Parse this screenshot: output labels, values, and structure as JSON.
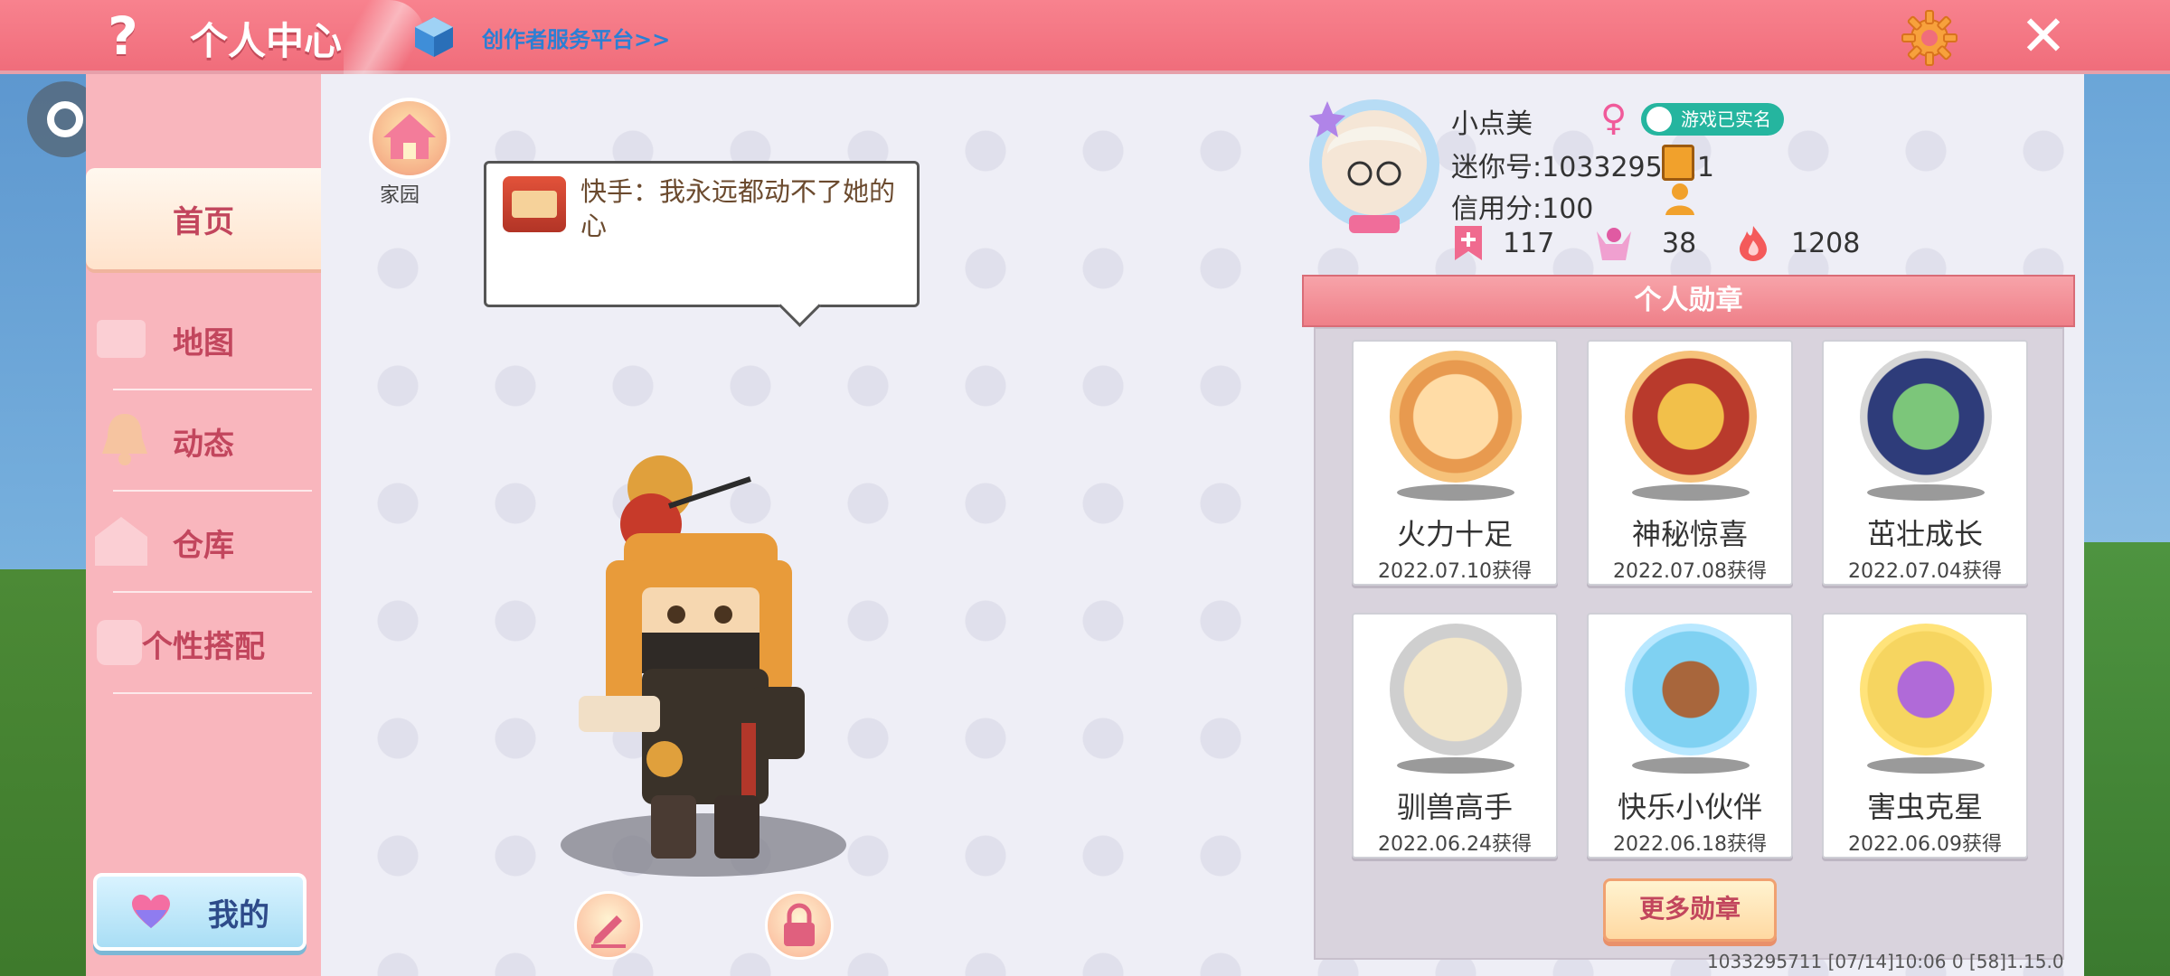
{
  "header": {
    "title": "个人中心",
    "creator_link": "创作者服务平台>>",
    "help_glyph": "?",
    "close_glyph": "✕"
  },
  "sidebar": {
    "items": [
      {
        "label": "首页",
        "active": true
      },
      {
        "label": "地图"
      },
      {
        "label": "动态"
      },
      {
        "label": "仓库"
      },
      {
        "label": "个性搭配"
      }
    ],
    "mine_label": "我的"
  },
  "main": {
    "home_label": "家园",
    "speech_text": "快手：我永远都动不了她的心"
  },
  "profile": {
    "name": "小点美",
    "gender_glyph": "♀",
    "verified_label": "游戏已实名",
    "mini_id": "迷你号:1033295711",
    "credit": "信用分:100",
    "stats": {
      "likes": "117",
      "fans": "38",
      "heat": "1208"
    }
  },
  "medals": {
    "header": "个人勋章",
    "items": [
      {
        "name": "火力十足",
        "date": "2022.07.10获得",
        "color": "#e89a4f"
      },
      {
        "name": "神秘惊喜",
        "date": "2022.07.08获得",
        "color": "#d9853f"
      },
      {
        "name": "茁壮成长",
        "date": "2022.07.04获得",
        "color": "#9a9a9a"
      },
      {
        "name": "驯兽高手",
        "date": "2022.06.24获得",
        "color": "#a9a9a9"
      },
      {
        "name": "快乐小伙伴",
        "date": "2022.06.18获得",
        "color": "#5ab7e6"
      },
      {
        "name": "害虫克星",
        "date": "2022.06.09获得",
        "color": "#e8b321"
      }
    ],
    "more_label": "更多勋章"
  },
  "footer": {
    "info": "1033295711   [07/14]10:06 0  [58]1.15.0"
  },
  "colors": {
    "topbar": "#f06d7b",
    "sidebar": "#f9b6bd",
    "accent_text": "#c2465d",
    "link": "#2c7fd4"
  }
}
